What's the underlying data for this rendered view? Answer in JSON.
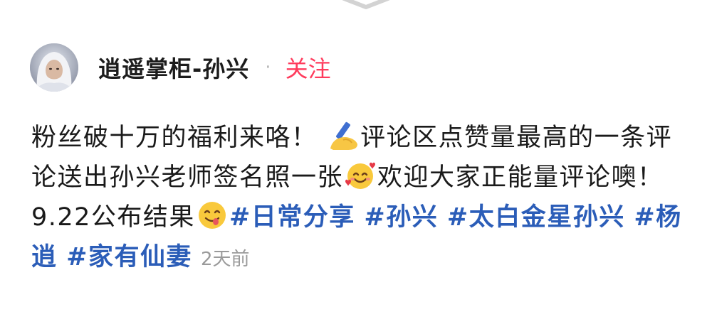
{
  "header": {
    "author_name": "逍遥掌柜-孙兴",
    "separator": "·",
    "follow_label": "关注"
  },
  "post": {
    "text_1": "粉丝破十万的福利来咯！ ",
    "text_2": "评论区点赞量最高的一条评论送出孙兴老师签名照一张",
    "text_3": "欢迎大家正能量评论噢！9.22公布结果",
    "tags": [
      "#日常分享",
      "#孙兴",
      "#太白金星孙兴",
      "#杨逍",
      "#家有仙妻"
    ],
    "time": "2天前",
    "icons": [
      "writing-hand-emoji",
      "smiling-face-with-hearts-emoji",
      "yum-face-emoji"
    ]
  },
  "colors": {
    "accent_follow": "#ff3b5c",
    "hashtag": "#2b5db8",
    "muted_text": "#9a9a9a"
  }
}
